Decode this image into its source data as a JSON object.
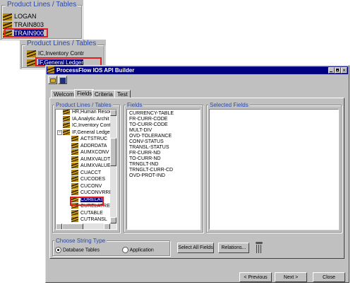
{
  "box1": {
    "title": "Product Lines / Tables",
    "items": [
      "LOGAN",
      "TRAIN803",
      "TRAIN900"
    ]
  },
  "box2": {
    "title": "Product Lines / Tables",
    "items": [
      "IC,Inventory Contr",
      "IF,General Ledger"
    ]
  },
  "window": {
    "title": "ProcessFlow IOS API Builder",
    "tabs": [
      "Welcome",
      "Fields",
      "Criteria",
      "Test"
    ],
    "product_lines_label": "Product Lines / Tables",
    "tree": [
      "HR,Human Resou",
      "IA,Analytic Archit",
      "IC,Inventory Contr",
      "IF,General Ledger",
      "ACTSTRUC",
      "ADDRDATA",
      "AUMXCONV",
      "AUMXVALDT",
      "AUMXVALUE",
      "CUACCT",
      "CUCODES",
      "CUCONV",
      "CUCONVRREL",
      "CURELAT",
      "CURELATRE",
      "CUTABLE",
      "CUTRANSL"
    ],
    "fields_label": "Fields",
    "fields": [
      "CURRENCY-TABLE",
      "FR-CURR-CODE",
      "TO-CURR-CODE",
      "MULT-DIV",
      "OVD-TOLERANCE",
      "CONV-STATUS",
      "TRANSL-STATUS",
      "FR-CURR-ND",
      "TO-CURR-ND",
      "TRNGLT-IND",
      "TRNGLT-CURR-CD",
      "OVD-PROT-IND"
    ],
    "selected_fields_label": "Selected Fields",
    "string_type_label": "Choose String Type",
    "radio_database": "Database Tables",
    "radio_application": "Application",
    "select_all": "Select All Fields",
    "relations": "Relations...",
    "previous": "< Previous",
    "next": "Next >",
    "close": "Close"
  }
}
